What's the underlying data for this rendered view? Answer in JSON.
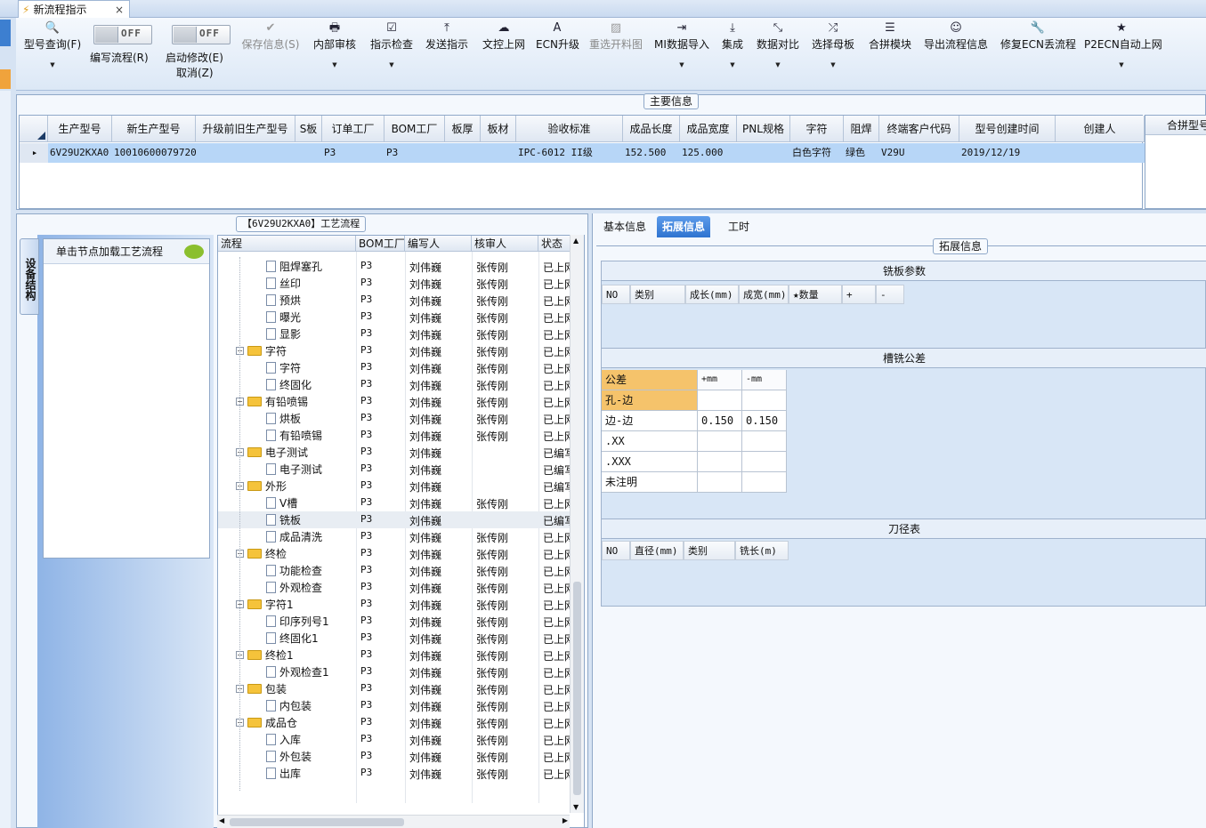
{
  "tab": {
    "title": "新流程指示",
    "close": "×"
  },
  "ribbon": {
    "buttons": [
      {
        "id": "model-query",
        "icon": "🔍",
        "label": "型号查询(F)",
        "dropdown": true,
        "disabled": false
      },
      {
        "id": "save-info",
        "icon": "✔",
        "label": "保存信息(S)",
        "dropdown": false,
        "disabled": true
      },
      {
        "id": "internal-review",
        "icon": "🖶",
        "label": "内部审核",
        "dropdown": true,
        "disabled": false
      },
      {
        "id": "instruction-check",
        "icon": "☑",
        "label": "指示检查",
        "dropdown": true,
        "disabled": false
      },
      {
        "id": "send-instruction",
        "icon": "⤒",
        "label": "发送指示",
        "dropdown": false,
        "disabled": false
      },
      {
        "id": "doc-upload",
        "icon": "☁",
        "label": "文控上网",
        "dropdown": false,
        "disabled": false
      },
      {
        "id": "ecn-upgrade",
        "icon": "A",
        "label": "ECN升级",
        "dropdown": false,
        "disabled": false
      },
      {
        "id": "cut-chart",
        "icon": "▨",
        "label": "重选开料图",
        "dropdown": false,
        "disabled": true
      },
      {
        "id": "mi-import",
        "icon": "⇥",
        "label": "MI数据导入",
        "dropdown": true,
        "disabled": false
      },
      {
        "id": "integrate",
        "icon": "⤓",
        "label": "集成",
        "dropdown": true,
        "disabled": false
      },
      {
        "id": "data-compare",
        "icon": "⤡",
        "label": "数据对比",
        "dropdown": true,
        "disabled": false
      },
      {
        "id": "select-mother",
        "icon": "⤮",
        "label": "选择母板",
        "dropdown": true,
        "disabled": false
      },
      {
        "id": "merge-module",
        "icon": "☰",
        "label": "合拼模块",
        "dropdown": false,
        "disabled": false
      },
      {
        "id": "export-flow",
        "icon": "☺",
        "label": "导出流程信息",
        "dropdown": false,
        "disabled": false
      },
      {
        "id": "fix-ecn",
        "icon": "🔧",
        "label": "修复ECN丢流程",
        "dropdown": false,
        "disabled": false
      },
      {
        "id": "p2ecn",
        "icon": "★",
        "label": "P2ECN自动上网",
        "dropdown": true,
        "disabled": false
      }
    ],
    "toggle1": {
      "state": "OFF",
      "label": "编写流程(R)"
    },
    "toggle2": {
      "state": "OFF",
      "label": "启动修改(E)",
      "sublabel": "取消(Z)"
    }
  },
  "main_info": {
    "title": "主要信息",
    "columns": [
      "生产型号",
      "新生产型号",
      "升级前旧生产型号",
      "S板",
      "订单工厂",
      "BOM工厂",
      "板厚",
      "板材",
      "验收标准",
      "成品长度",
      "成品宽度",
      "PNL规格",
      "字符",
      "阻焊",
      "终端客户代码",
      "型号创建时间",
      "创建人"
    ],
    "row": [
      "6V29U2KXA0",
      "10010600079720",
      "",
      "",
      "P3",
      "P3",
      "",
      "",
      "IPC-6012 II级",
      "152.500",
      "125.000",
      "",
      "白色字符",
      "绿色",
      "V29U",
      "2019/12/19",
      ""
    ],
    "merge_label": "合拼型号"
  },
  "flow": {
    "title": "【6V29U2KXA0】工艺流程",
    "side_tab": "设备结构",
    "node_hint": "单击节点加载工艺流程",
    "columns": [
      "流程",
      "BOM工厂",
      "编写人",
      "核审人",
      "状态"
    ],
    "rows": [
      {
        "name": "阻焊塞孔",
        "lvl": 2,
        "bom": "P3",
        "writer": "刘伟巍",
        "rev": "张传刚",
        "status": "已上网"
      },
      {
        "name": "丝印",
        "lvl": 2,
        "bom": "P3",
        "writer": "刘伟巍",
        "rev": "张传刚",
        "status": "已上网"
      },
      {
        "name": "预烘",
        "lvl": 2,
        "bom": "P3",
        "writer": "刘伟巍",
        "rev": "张传刚",
        "status": "已上网"
      },
      {
        "name": "曝光",
        "lvl": 2,
        "bom": "P3",
        "writer": "刘伟巍",
        "rev": "张传刚",
        "status": "已上网"
      },
      {
        "name": "显影",
        "lvl": 2,
        "bom": "P3",
        "writer": "刘伟巍",
        "rev": "张传刚",
        "status": "已上网"
      },
      {
        "name": "字符",
        "lvl": 1,
        "bom": "P3",
        "writer": "刘伟巍",
        "rev": "张传刚",
        "status": "已上网"
      },
      {
        "name": "字符",
        "lvl": 2,
        "bom": "P3",
        "writer": "刘伟巍",
        "rev": "张传刚",
        "status": "已上网"
      },
      {
        "name": "终固化",
        "lvl": 2,
        "bom": "P3",
        "writer": "刘伟巍",
        "rev": "张传刚",
        "status": "已上网"
      },
      {
        "name": "有铅喷锡",
        "lvl": 1,
        "bom": "P3",
        "writer": "刘伟巍",
        "rev": "张传刚",
        "status": "已上网"
      },
      {
        "name": "烘板",
        "lvl": 2,
        "bom": "P3",
        "writer": "刘伟巍",
        "rev": "张传刚",
        "status": "已上网"
      },
      {
        "name": "有铅喷锡",
        "lvl": 2,
        "bom": "P3",
        "writer": "刘伟巍",
        "rev": "张传刚",
        "status": "已上网"
      },
      {
        "name": "电子测试",
        "lvl": 1,
        "bom": "P3",
        "writer": "刘伟巍",
        "rev": "",
        "status": "已编写"
      },
      {
        "name": "电子测试",
        "lvl": 2,
        "bom": "P3",
        "writer": "刘伟巍",
        "rev": "",
        "status": "已编写"
      },
      {
        "name": "外形",
        "lvl": 1,
        "bom": "P3",
        "writer": "刘伟巍",
        "rev": "",
        "status": "已编写"
      },
      {
        "name": "V槽",
        "lvl": 2,
        "bom": "P3",
        "writer": "刘伟巍",
        "rev": "张传刚",
        "status": "已上网"
      },
      {
        "name": "铣板",
        "lvl": 2,
        "bom": "P3",
        "writer": "刘伟巍",
        "rev": "",
        "status": "已编写",
        "selected": true
      },
      {
        "name": "成品清洗",
        "lvl": 2,
        "bom": "P3",
        "writer": "刘伟巍",
        "rev": "张传刚",
        "status": "已上网"
      },
      {
        "name": "终检",
        "lvl": 1,
        "bom": "P3",
        "writer": "刘伟巍",
        "rev": "张传刚",
        "status": "已上网"
      },
      {
        "name": "功能检查",
        "lvl": 2,
        "bom": "P3",
        "writer": "刘伟巍",
        "rev": "张传刚",
        "status": "已上网"
      },
      {
        "name": "外观检查",
        "lvl": 2,
        "bom": "P3",
        "writer": "刘伟巍",
        "rev": "张传刚",
        "status": "已上网"
      },
      {
        "name": "字符1",
        "lvl": 1,
        "bom": "P3",
        "writer": "刘伟巍",
        "rev": "张传刚",
        "status": "已上网"
      },
      {
        "name": "印序列号1",
        "lvl": 2,
        "bom": "P3",
        "writer": "刘伟巍",
        "rev": "张传刚",
        "status": "已上网"
      },
      {
        "name": "终固化1",
        "lvl": 2,
        "bom": "P3",
        "writer": "刘伟巍",
        "rev": "张传刚",
        "status": "已上网"
      },
      {
        "name": "终检1",
        "lvl": 1,
        "bom": "P3",
        "writer": "刘伟巍",
        "rev": "张传刚",
        "status": "已上网"
      },
      {
        "name": "外观检查1",
        "lvl": 2,
        "bom": "P3",
        "writer": "刘伟巍",
        "rev": "张传刚",
        "status": "已上网"
      },
      {
        "name": "包装",
        "lvl": 1,
        "bom": "P3",
        "writer": "刘伟巍",
        "rev": "张传刚",
        "status": "已上网"
      },
      {
        "name": "内包装",
        "lvl": 2,
        "bom": "P3",
        "writer": "刘伟巍",
        "rev": "张传刚",
        "status": "已上网"
      },
      {
        "name": "成品仓",
        "lvl": 1,
        "bom": "P3",
        "writer": "刘伟巍",
        "rev": "张传刚",
        "status": "已上网"
      },
      {
        "name": "入库",
        "lvl": 2,
        "bom": "P3",
        "writer": "刘伟巍",
        "rev": "张传刚",
        "status": "已上网"
      },
      {
        "name": "外包装",
        "lvl": 2,
        "bom": "P3",
        "writer": "刘伟巍",
        "rev": "张传刚",
        "status": "已上网"
      },
      {
        "name": "出库",
        "lvl": 2,
        "bom": "P3",
        "writer": "刘伟巍",
        "rev": "张传刚",
        "status": "已上网"
      }
    ]
  },
  "right": {
    "tabs": [
      "基本信息",
      "拓展信息",
      "工时"
    ],
    "active_tab": 1,
    "group_title": "拓展信息",
    "mill_params": {
      "title": "铣板参数",
      "columns": [
        "NO",
        "类别",
        "成长(mm)",
        "成宽(mm)",
        "★数量",
        "+",
        "-"
      ]
    },
    "slot_tol": {
      "title": "槽铣公差",
      "header": [
        "公差",
        "+mm",
        "-mm"
      ],
      "rows": [
        [
          "孔-边",
          "",
          ""
        ],
        [
          "边-边",
          "0.150",
          "0.150"
        ],
        [
          ".XX",
          "",
          ""
        ],
        [
          ".XXX",
          "",
          ""
        ],
        [
          "未注明",
          "",
          ""
        ]
      ]
    },
    "tool_table": {
      "title": "刀径表",
      "columns": [
        "NO",
        "直径(mm)",
        "类别",
        "铣长(m)"
      ]
    }
  },
  "colors": {
    "accent": "#2f74d0",
    "selection": "#b7d6f7",
    "header_cell": "#f5c36b"
  }
}
